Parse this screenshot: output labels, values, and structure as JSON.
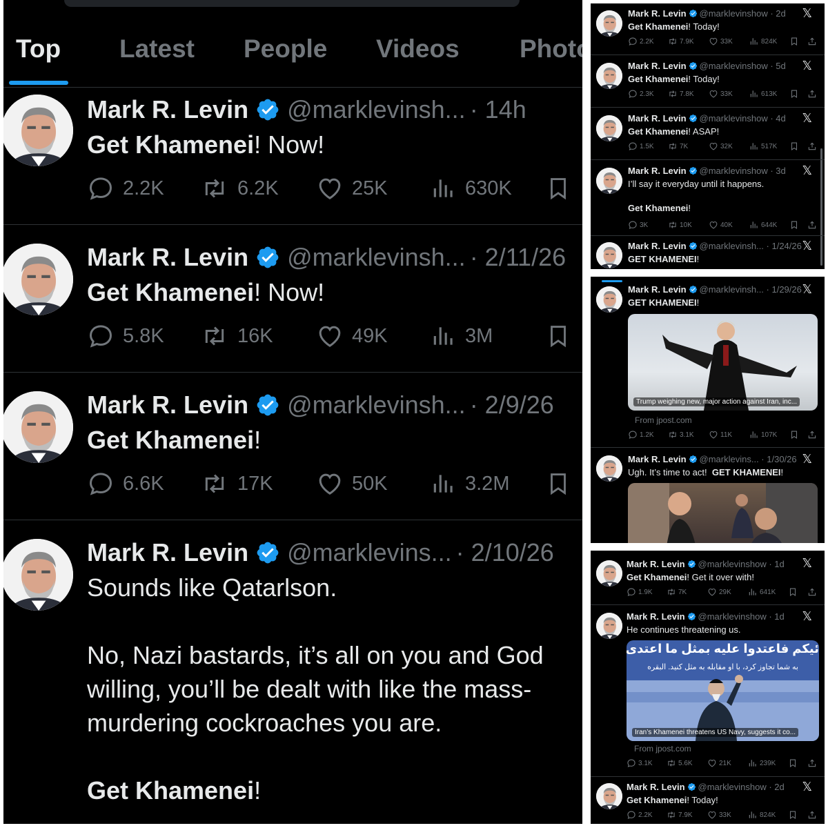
{
  "left_panel": {
    "tabs": [
      {
        "label": "Top",
        "active": true
      },
      {
        "label": "Latest",
        "active": false
      },
      {
        "label": "People",
        "active": false
      },
      {
        "label": "Videos",
        "active": false
      },
      {
        "label": "Photo",
        "active": false
      }
    ],
    "tweets": [
      {
        "name": "Mark R. Levin",
        "handle": "@marklevinsh...",
        "time": "· 14h",
        "text_bold": "Get Khamenei",
        "text_rest": "!  Now!",
        "replies": "2.2K",
        "reposts": "6.2K",
        "likes": "25K",
        "views": "630K"
      },
      {
        "name": "Mark R. Levin",
        "handle": "@marklevinsh...",
        "time": "· 2/11/26",
        "text_bold": "Get Khamenei",
        "text_rest": "!  Now!",
        "replies": "5.8K",
        "reposts": "16K",
        "likes": "49K",
        "views": "3M"
      },
      {
        "name": "Mark R. Levin",
        "handle": "@marklevinsh...",
        "time": "· 2/9/26",
        "text_bold": "Get Khamenei",
        "text_rest": "!",
        "replies": "6.6K",
        "reposts": "17K",
        "likes": "50K",
        "views": "3.2M"
      },
      {
        "name": "Mark R. Levin",
        "handle": "@marklevins...",
        "time": "· 2/10/26",
        "line1": "Sounds like Qatarlson.",
        "line2": "No, Nazi bastards, it’s all on you and God",
        "line3": "willing, you’ll be dealt with like the mass-",
        "line4": "murdering cockroaches you are.",
        "text_bold": "Get Khamenei",
        "text_rest": "!"
      }
    ]
  },
  "panel_a": {
    "tweets": [
      {
        "name": "Mark R. Levin",
        "handle": "@marklevinshow · 2d",
        "text_bold": "Get Khamenei",
        "text_rest": "!  Today!",
        "replies": "2.2K",
        "reposts": "7.9K",
        "likes": "33K",
        "views": "824K"
      },
      {
        "name": "Mark R. Levin",
        "handle": "@marklevinshow · 5d",
        "text_bold": "Get Khamenei",
        "text_rest": "! Today!",
        "replies": "2.3K",
        "reposts": "7.8K",
        "likes": "33K",
        "views": "613K"
      },
      {
        "name": "Mark R. Levin",
        "handle": "@marklevinshow · 4d",
        "text_bold": "Get Khamenei",
        "text_rest": "!  ASAP!",
        "replies": "1.5K",
        "reposts": "7K",
        "likes": "32K",
        "views": "517K"
      },
      {
        "name": "Mark R. Levin",
        "handle": "@marklevinshow · 3d",
        "text_plain": "I’ll say it everyday until it happens.",
        "text_bold": "Get Khamenei",
        "text_rest": "!",
        "replies": "3K",
        "reposts": "10K",
        "likes": "40K",
        "views": "644K"
      },
      {
        "name": "Mark R. Levin",
        "handle": "@marklevinsh... · 1/24/26",
        "text_bold": "GET KHAMENEI",
        "text_rest": "!"
      }
    ]
  },
  "panel_b": {
    "tweets": [
      {
        "name": "Mark R. Levin",
        "handle": "@marklevinsh... · 1/29/26",
        "text_bold": "GET KHAMENEI",
        "text_rest": "!",
        "card_caption": "Trump weighing new, major action against Iran, inc...",
        "card_source": "From jpost.com",
        "replies": "1.2K",
        "reposts": "3.1K",
        "likes": "11K",
        "views": "107K"
      },
      {
        "name": "Mark R. Levin",
        "handle": "@marklevins... · 1/30/26",
        "text_plain": "Ugh. It’s time to act!  ",
        "text_bold": "GET KHAMENEI",
        "text_rest": "!"
      }
    ]
  },
  "panel_c": {
    "tweets": [
      {
        "name": "Mark R. Levin",
        "handle": "@marklevinshow · 1d",
        "text_bold": "Get Khamenei",
        "text_rest": "! Get it over with!",
        "replies": "1.9K",
        "reposts": "7K",
        "likes": "29K",
        "views": "641K"
      },
      {
        "name": "Mark R. Levin",
        "handle": "@marklevinshow · 1d",
        "text_plain": "He continues threatening us.",
        "card_caption": "Iran’s Khamenei threatens US Navy, suggests it co...",
        "card_source": "From jpost.com",
        "card_banner_line1": "ئیکم فاعتدوا علیه بمثل ما اعتدی",
        "card_banner_line2": "به شما تجاوز کرد، با او مقابله به مثل کنید. البقره",
        "replies": "3.1K",
        "reposts": "5.6K",
        "likes": "21K",
        "views": "239K"
      },
      {
        "name": "Mark R. Levin",
        "handle": "@marklevinshow · 2d",
        "text_bold": "Get Khamenei",
        "text_rest": "!  Today!",
        "replies": "2.2K",
        "reposts": "7.9K",
        "likes": "33K",
        "views": "824K"
      }
    ]
  },
  "icons": {
    "verified": "verified-badge-icon",
    "reply": "reply-icon",
    "repost": "repost-icon",
    "like": "like-icon",
    "views": "views-icon",
    "bookmark": "bookmark-icon",
    "share": "share-icon",
    "x_logo": "x-logo-icon"
  },
  "colors": {
    "background": "#000000",
    "text": "#e7e9ea",
    "muted": "#71767b",
    "accent": "#1d9bf0",
    "divider": "#2f3336"
  }
}
